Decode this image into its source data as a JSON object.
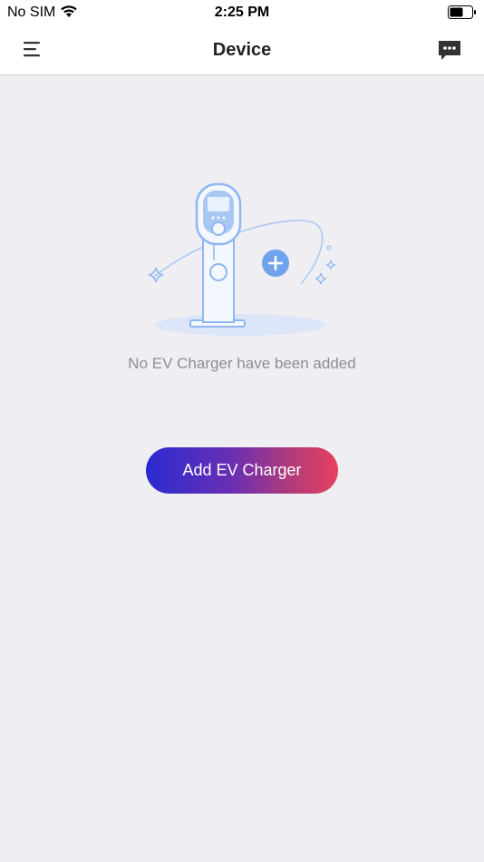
{
  "status_bar": {
    "carrier": "No SIM",
    "time": "2:25 PM"
  },
  "header": {
    "title": "Device",
    "menu_icon": "menu-icon",
    "message_icon": "chat-bubble-icon"
  },
  "empty_state": {
    "message": "No EV Charger have been added",
    "illustration": "ev-charger-illustration"
  },
  "actions": {
    "add_label": "Add EV Charger"
  },
  "colors": {
    "background": "#eeeef3",
    "gradient_start": "#2a2ad0",
    "gradient_end": "#e84060",
    "illustration_blue": "#8fb8f0"
  }
}
